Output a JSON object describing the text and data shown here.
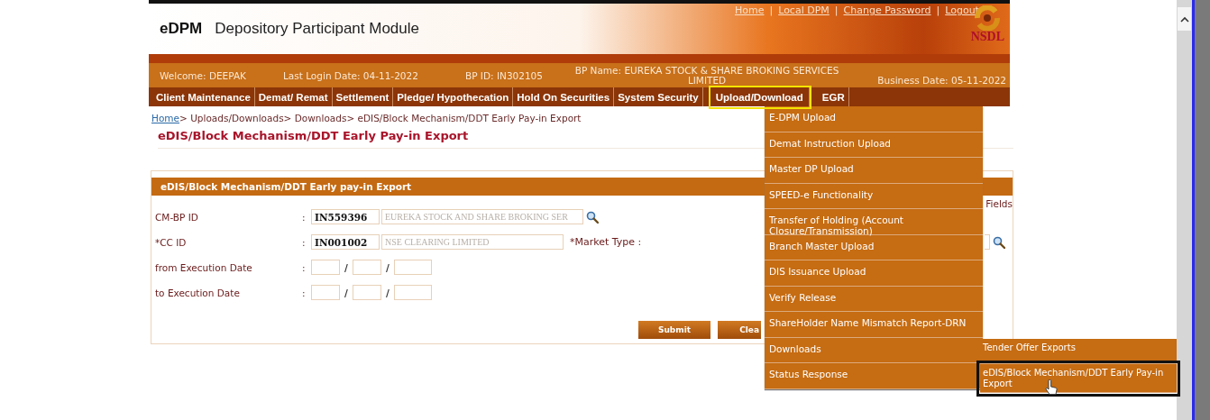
{
  "header": {
    "app_name": "eDPM",
    "app_title": "Depository Participant Module",
    "top_links": [
      "Home",
      "Local DPM",
      "Change Password",
      "Logout"
    ],
    "link_separators": [
      "|",
      "|",
      "|"
    ],
    "logo_text": "NSDL"
  },
  "info_bar": {
    "welcome": "Welcome: DEEPAK",
    "last_login": "Last Login Date: 04-11-2022",
    "bp_id": "BP ID: IN302105",
    "bp_name": "BP Name: EUREKA STOCK & SHARE BROKING SERVICES LIMITED",
    "business_date": "Business Date: 05-11-2022"
  },
  "menu": [
    {
      "label": "Client Maintenance",
      "selected": false
    },
    {
      "label": "Demat/ Remat",
      "selected": false
    },
    {
      "label": "Settlement",
      "selected": false
    },
    {
      "label": "Pledge/ Hypothecation",
      "selected": false
    },
    {
      "label": "Hold On Securities",
      "selected": false
    },
    {
      "label": "System Security",
      "selected": false
    },
    {
      "label": "Upload/Download",
      "selected": true
    },
    {
      "label": "EGR",
      "selected": false
    }
  ],
  "breadcrumb": {
    "link": "Home",
    "trail": "> Uploads/Downloads> Downloads> eDIS/Block Mechanism/DDT Early Pay-in Export"
  },
  "page_title": "eDIS/Block Mechanism/DDT Early Pay-in Export",
  "form": {
    "title": "eDIS/Block Mechanism/DDT Early pay-in Export",
    "mandatory_note": "Fields",
    "rows": [
      {
        "kind": "lookup",
        "label": "CM-BP ID",
        "colon": ":",
        "value": "IN559396",
        "description": "EUREKA STOCK AND SHARE BROKING SER"
      },
      {
        "kind": "lookup-market",
        "label": "*CC ID",
        "colon": ":",
        "value": "IN001002",
        "description": "NSE CLEARING LIMITED",
        "extra_label": "*Market Type :"
      },
      {
        "kind": "date",
        "label": "from Execution Date",
        "colon": ":",
        "separators": [
          "/",
          "/"
        ]
      },
      {
        "kind": "date",
        "label": "to Execution Date",
        "colon": ":",
        "separators": [
          "/",
          "/"
        ]
      }
    ],
    "buttons": [
      "Submit",
      "Clea"
    ]
  },
  "dropdown": [
    {
      "label": "E-DPM Upload"
    },
    {
      "label": "Demat Instruction Upload"
    },
    {
      "label": "Master DP Upload"
    },
    {
      "label": "SPEED-e Functionality"
    },
    {
      "label": "Transfer of Holding (Account Closure/Transmission)"
    },
    {
      "label": "Branch Master Upload"
    },
    {
      "label": "DIS Issuance Upload"
    },
    {
      "label": "Verify Release"
    },
    {
      "label": "ShareHolder Name Mismatch Report-DRN"
    },
    {
      "label": "Downloads"
    },
    {
      "label": "Status Response"
    }
  ],
  "submenu": [
    {
      "label": "Tender Offer Exports",
      "selected": false
    },
    {
      "label": "eDIS/Block Mechanism/DDT Early Pay-in Export",
      "selected": true
    }
  ]
}
